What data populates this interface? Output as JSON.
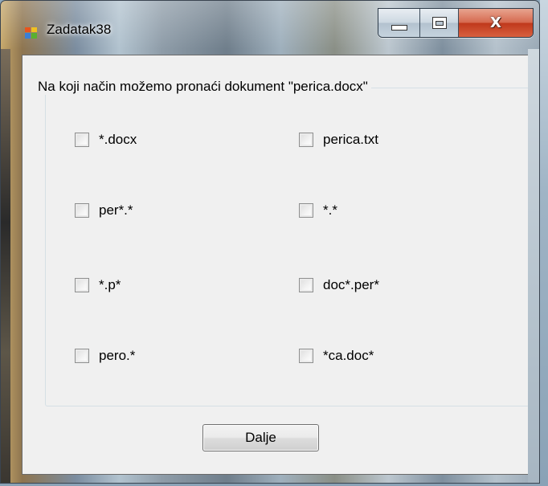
{
  "window": {
    "title": "Zadatak38",
    "icon": "windows-form-icon",
    "controls": {
      "minimize_icon": "minimize-icon",
      "maximize_icon": "maximize-icon",
      "close_label": "X"
    }
  },
  "group": {
    "legend": "Na koji način možemo pronaći dokument \"perica.docx\""
  },
  "options": [
    {
      "label": "*.docx",
      "checked": false
    },
    {
      "label": "perica.txt",
      "checked": false
    },
    {
      "label": "per*.*",
      "checked": false
    },
    {
      "label": "*.*",
      "checked": false
    },
    {
      "label": "*.p*",
      "checked": false
    },
    {
      "label": "doc*.per*",
      "checked": false
    },
    {
      "label": "pero.*",
      "checked": false
    },
    {
      "label": "*ca.doc*",
      "checked": false
    }
  ],
  "button": {
    "label": "Dalje"
  }
}
